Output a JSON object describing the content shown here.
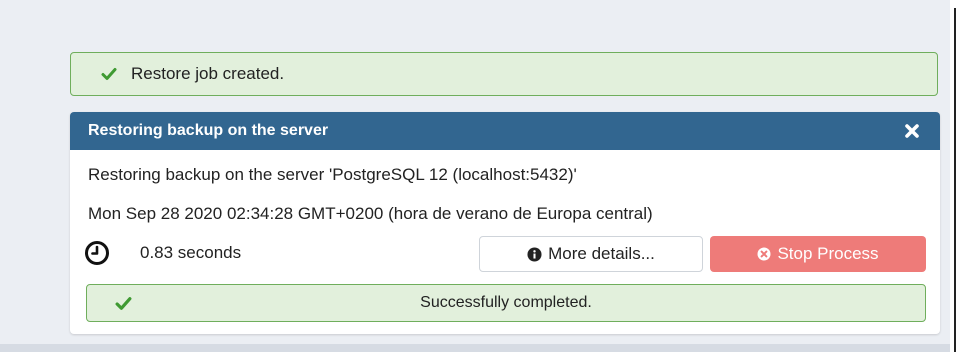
{
  "toast": {
    "message": "Restore job created.",
    "icon": "check-icon",
    "color": "#3f9a32"
  },
  "panel": {
    "title": "Restoring backup on the server",
    "close_icon": "close-icon",
    "header_color": "#326690",
    "description": "Restoring backup on the server 'PostgreSQL 12 (localhost:5432)'",
    "start_time": "Mon Sep 28 2020 02:34:28 GMT+0200 (hora de verano de Europa central)",
    "elapsed": "0.83 seconds",
    "more_details_label": "More details...",
    "stop_label": "Stop Process",
    "stop_color": "#ee7b79",
    "status": "Successfully completed."
  }
}
